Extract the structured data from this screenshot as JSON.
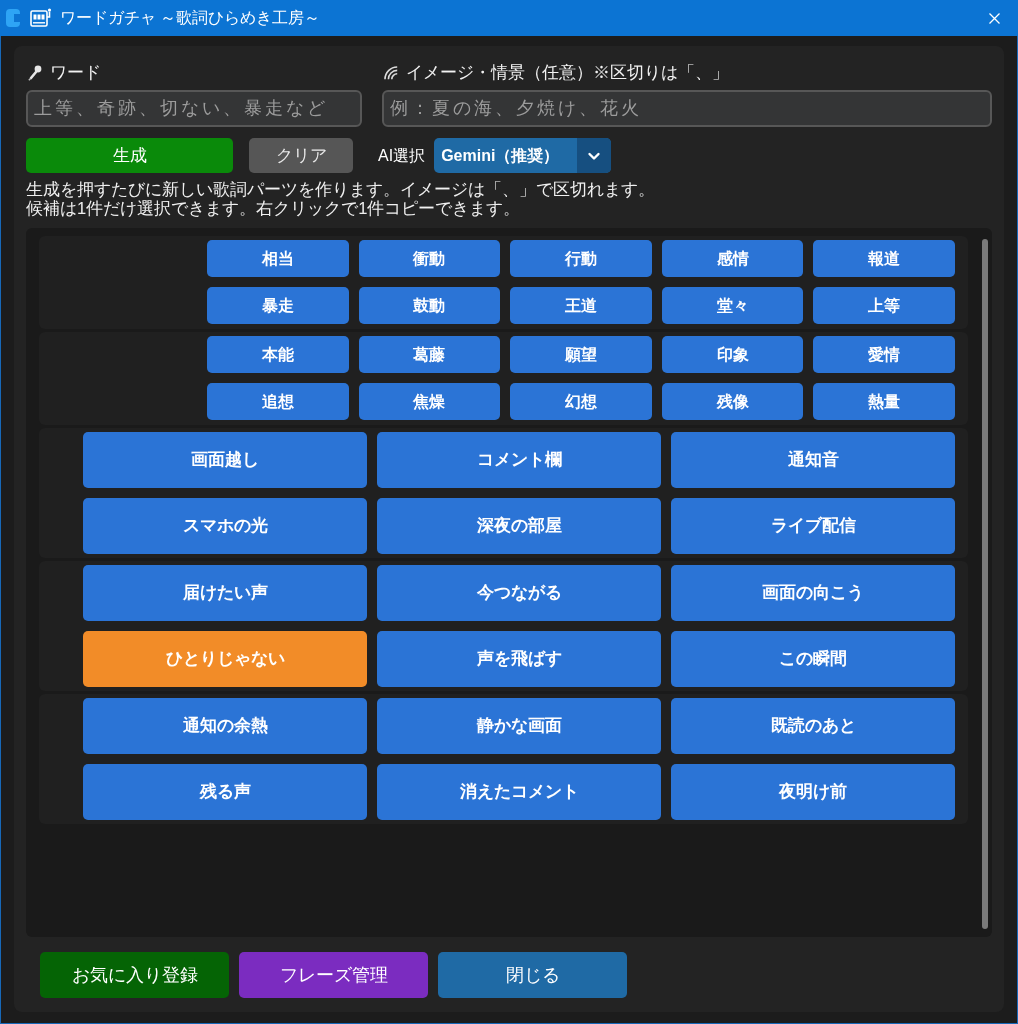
{
  "window": {
    "title": "ワードガチャ ～歌詞ひらめき工房～"
  },
  "fields": [
    {
      "kind": "word",
      "label": "ワード",
      "placeholder": "上等、奇跡、切ない、暴走など"
    },
    {
      "kind": "image",
      "label": "イメージ・情景（任意）※区切りは「、」",
      "placeholder": "例：夏の海、夕焼け、花火"
    }
  ],
  "actions": [
    {
      "kind": "generate",
      "label": "生成"
    },
    {
      "kind": "clear",
      "label": "クリア"
    }
  ],
  "ai_select": {
    "label": "AI選択",
    "value": "Gemini（推奨）"
  },
  "help": [
    "生成を押すたびに新しい歌詞パーツを作ります。イメージは「、」で区切れます。",
    "候補は1件だけ選択できます。右クリックで1件コピーできます。"
  ],
  "candidate_groups": [
    {
      "kind": "word",
      "items": [
        {
          "text": "相当",
          "selected": false
        },
        {
          "text": "衝動",
          "selected": false
        },
        {
          "text": "行動",
          "selected": false
        },
        {
          "text": "感情",
          "selected": false
        },
        {
          "text": "報道",
          "selected": false
        },
        {
          "text": "暴走",
          "selected": false
        },
        {
          "text": "鼓動",
          "selected": false
        },
        {
          "text": "王道",
          "selected": false
        },
        {
          "text": "堂々",
          "selected": false
        },
        {
          "text": "上等",
          "selected": false
        }
      ]
    },
    {
      "kind": "word",
      "items": [
        {
          "text": "本能",
          "selected": false
        },
        {
          "text": "葛藤",
          "selected": false
        },
        {
          "text": "願望",
          "selected": false
        },
        {
          "text": "印象",
          "selected": false
        },
        {
          "text": "愛情",
          "selected": false
        },
        {
          "text": "追想",
          "selected": false
        },
        {
          "text": "焦燥",
          "selected": false
        },
        {
          "text": "幻想",
          "selected": false
        },
        {
          "text": "残像",
          "selected": false
        },
        {
          "text": "熱量",
          "selected": false
        }
      ]
    },
    {
      "kind": "phrase",
      "items": [
        {
          "text": "画面越し",
          "selected": false
        },
        {
          "text": "コメント欄",
          "selected": false
        },
        {
          "text": "通知音",
          "selected": false
        },
        {
          "text": "スマホの光",
          "selected": false
        },
        {
          "text": "深夜の部屋",
          "selected": false
        },
        {
          "text": "ライブ配信",
          "selected": false
        }
      ]
    },
    {
      "kind": "phrase",
      "items": [
        {
          "text": "届けたい声",
          "selected": false
        },
        {
          "text": "今つながる",
          "selected": false
        },
        {
          "text": "画面の向こう",
          "selected": false
        },
        {
          "text": "ひとりじゃない",
          "selected": true
        },
        {
          "text": "声を飛ばす",
          "selected": false
        },
        {
          "text": "この瞬間",
          "selected": false
        }
      ]
    },
    {
      "kind": "phrase",
      "items": [
        {
          "text": "通知の余熱",
          "selected": false
        },
        {
          "text": "静かな画面",
          "selected": false
        },
        {
          "text": "既読のあと",
          "selected": false
        },
        {
          "text": "残る声",
          "selected": false
        },
        {
          "text": "消えたコメント",
          "selected": false
        },
        {
          "text": "夜明け前",
          "selected": false
        }
      ]
    }
  ],
  "footer_buttons": [
    {
      "kind": "favorite",
      "label": "お気に入り登録"
    },
    {
      "kind": "phrases",
      "label": "フレーズ管理"
    },
    {
      "kind": "close",
      "label": "閉じる"
    }
  ]
}
